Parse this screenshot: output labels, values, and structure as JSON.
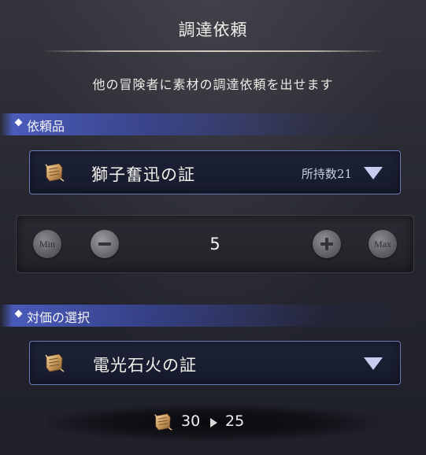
{
  "title": "調達依頼",
  "subtitle": "他の冒険者に素材の調達依頼を出せます",
  "request_section": {
    "label": "依頼品",
    "item": {
      "icon": "scroll-icon",
      "name": "獅子奮迅の証",
      "owned": "所持数21"
    }
  },
  "quantity": {
    "min_label": "Min",
    "max_label": "Max",
    "value": "5"
  },
  "reward_section": {
    "label": "対価の選択",
    "item": {
      "icon": "scroll-icon",
      "name": "電光石火の証"
    }
  },
  "cost": {
    "from": "30",
    "to": "25"
  },
  "colors": {
    "accent_blue": "#5060c8",
    "border_blue": "#6a78b8",
    "arrow": "#c6cdef"
  }
}
